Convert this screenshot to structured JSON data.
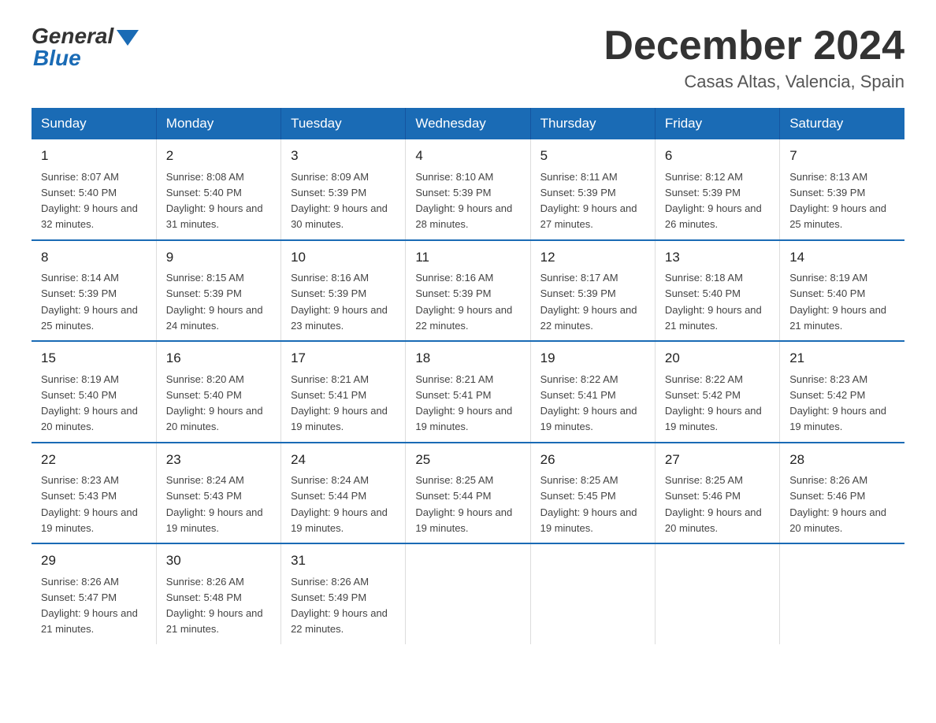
{
  "header": {
    "logo_general": "General",
    "logo_blue": "Blue",
    "month_title": "December 2024",
    "location": "Casas Altas, Valencia, Spain"
  },
  "days_of_week": [
    "Sunday",
    "Monday",
    "Tuesday",
    "Wednesday",
    "Thursday",
    "Friday",
    "Saturday"
  ],
  "weeks": [
    [
      {
        "day": "1",
        "sunrise": "Sunrise: 8:07 AM",
        "sunset": "Sunset: 5:40 PM",
        "daylight": "Daylight: 9 hours and 32 minutes."
      },
      {
        "day": "2",
        "sunrise": "Sunrise: 8:08 AM",
        "sunset": "Sunset: 5:40 PM",
        "daylight": "Daylight: 9 hours and 31 minutes."
      },
      {
        "day": "3",
        "sunrise": "Sunrise: 8:09 AM",
        "sunset": "Sunset: 5:39 PM",
        "daylight": "Daylight: 9 hours and 30 minutes."
      },
      {
        "day": "4",
        "sunrise": "Sunrise: 8:10 AM",
        "sunset": "Sunset: 5:39 PM",
        "daylight": "Daylight: 9 hours and 28 minutes."
      },
      {
        "day": "5",
        "sunrise": "Sunrise: 8:11 AM",
        "sunset": "Sunset: 5:39 PM",
        "daylight": "Daylight: 9 hours and 27 minutes."
      },
      {
        "day": "6",
        "sunrise": "Sunrise: 8:12 AM",
        "sunset": "Sunset: 5:39 PM",
        "daylight": "Daylight: 9 hours and 26 minutes."
      },
      {
        "day": "7",
        "sunrise": "Sunrise: 8:13 AM",
        "sunset": "Sunset: 5:39 PM",
        "daylight": "Daylight: 9 hours and 25 minutes."
      }
    ],
    [
      {
        "day": "8",
        "sunrise": "Sunrise: 8:14 AM",
        "sunset": "Sunset: 5:39 PM",
        "daylight": "Daylight: 9 hours and 25 minutes."
      },
      {
        "day": "9",
        "sunrise": "Sunrise: 8:15 AM",
        "sunset": "Sunset: 5:39 PM",
        "daylight": "Daylight: 9 hours and 24 minutes."
      },
      {
        "day": "10",
        "sunrise": "Sunrise: 8:16 AM",
        "sunset": "Sunset: 5:39 PM",
        "daylight": "Daylight: 9 hours and 23 minutes."
      },
      {
        "day": "11",
        "sunrise": "Sunrise: 8:16 AM",
        "sunset": "Sunset: 5:39 PM",
        "daylight": "Daylight: 9 hours and 22 minutes."
      },
      {
        "day": "12",
        "sunrise": "Sunrise: 8:17 AM",
        "sunset": "Sunset: 5:39 PM",
        "daylight": "Daylight: 9 hours and 22 minutes."
      },
      {
        "day": "13",
        "sunrise": "Sunrise: 8:18 AM",
        "sunset": "Sunset: 5:40 PM",
        "daylight": "Daylight: 9 hours and 21 minutes."
      },
      {
        "day": "14",
        "sunrise": "Sunrise: 8:19 AM",
        "sunset": "Sunset: 5:40 PM",
        "daylight": "Daylight: 9 hours and 21 minutes."
      }
    ],
    [
      {
        "day": "15",
        "sunrise": "Sunrise: 8:19 AM",
        "sunset": "Sunset: 5:40 PM",
        "daylight": "Daylight: 9 hours and 20 minutes."
      },
      {
        "day": "16",
        "sunrise": "Sunrise: 8:20 AM",
        "sunset": "Sunset: 5:40 PM",
        "daylight": "Daylight: 9 hours and 20 minutes."
      },
      {
        "day": "17",
        "sunrise": "Sunrise: 8:21 AM",
        "sunset": "Sunset: 5:41 PM",
        "daylight": "Daylight: 9 hours and 19 minutes."
      },
      {
        "day": "18",
        "sunrise": "Sunrise: 8:21 AM",
        "sunset": "Sunset: 5:41 PM",
        "daylight": "Daylight: 9 hours and 19 minutes."
      },
      {
        "day": "19",
        "sunrise": "Sunrise: 8:22 AM",
        "sunset": "Sunset: 5:41 PM",
        "daylight": "Daylight: 9 hours and 19 minutes."
      },
      {
        "day": "20",
        "sunrise": "Sunrise: 8:22 AM",
        "sunset": "Sunset: 5:42 PM",
        "daylight": "Daylight: 9 hours and 19 minutes."
      },
      {
        "day": "21",
        "sunrise": "Sunrise: 8:23 AM",
        "sunset": "Sunset: 5:42 PM",
        "daylight": "Daylight: 9 hours and 19 minutes."
      }
    ],
    [
      {
        "day": "22",
        "sunrise": "Sunrise: 8:23 AM",
        "sunset": "Sunset: 5:43 PM",
        "daylight": "Daylight: 9 hours and 19 minutes."
      },
      {
        "day": "23",
        "sunrise": "Sunrise: 8:24 AM",
        "sunset": "Sunset: 5:43 PM",
        "daylight": "Daylight: 9 hours and 19 minutes."
      },
      {
        "day": "24",
        "sunrise": "Sunrise: 8:24 AM",
        "sunset": "Sunset: 5:44 PM",
        "daylight": "Daylight: 9 hours and 19 minutes."
      },
      {
        "day": "25",
        "sunrise": "Sunrise: 8:25 AM",
        "sunset": "Sunset: 5:44 PM",
        "daylight": "Daylight: 9 hours and 19 minutes."
      },
      {
        "day": "26",
        "sunrise": "Sunrise: 8:25 AM",
        "sunset": "Sunset: 5:45 PM",
        "daylight": "Daylight: 9 hours and 19 minutes."
      },
      {
        "day": "27",
        "sunrise": "Sunrise: 8:25 AM",
        "sunset": "Sunset: 5:46 PM",
        "daylight": "Daylight: 9 hours and 20 minutes."
      },
      {
        "day": "28",
        "sunrise": "Sunrise: 8:26 AM",
        "sunset": "Sunset: 5:46 PM",
        "daylight": "Daylight: 9 hours and 20 minutes."
      }
    ],
    [
      {
        "day": "29",
        "sunrise": "Sunrise: 8:26 AM",
        "sunset": "Sunset: 5:47 PM",
        "daylight": "Daylight: 9 hours and 21 minutes."
      },
      {
        "day": "30",
        "sunrise": "Sunrise: 8:26 AM",
        "sunset": "Sunset: 5:48 PM",
        "daylight": "Daylight: 9 hours and 21 minutes."
      },
      {
        "day": "31",
        "sunrise": "Sunrise: 8:26 AM",
        "sunset": "Sunset: 5:49 PM",
        "daylight": "Daylight: 9 hours and 22 minutes."
      },
      null,
      null,
      null,
      null
    ]
  ]
}
